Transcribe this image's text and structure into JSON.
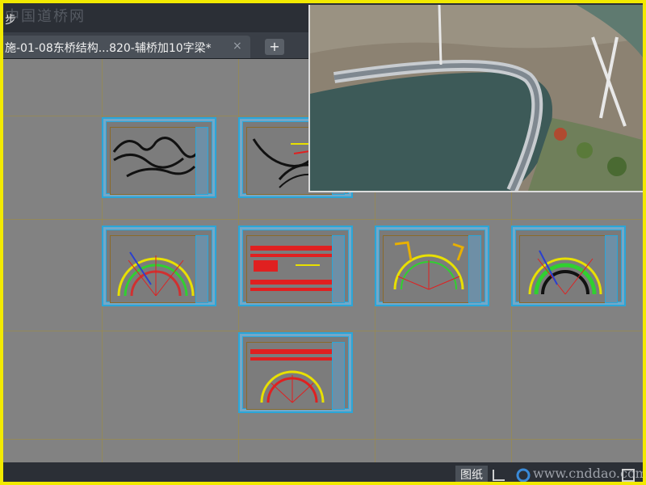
{
  "watermark_top": "中国道桥网",
  "step_label": "步",
  "document_tab": {
    "label": "施-01-08东桥结构...820-辅桥加10字梁*",
    "close": "×"
  },
  "add_tab": "+",
  "status_bar": {
    "layout_label": "图纸"
  },
  "watermark_bottom": "www.cnddao.com",
  "colors": {
    "sheet_border": "#2aa6d8",
    "canvas": "#828282",
    "frame": "#f2ea00"
  }
}
